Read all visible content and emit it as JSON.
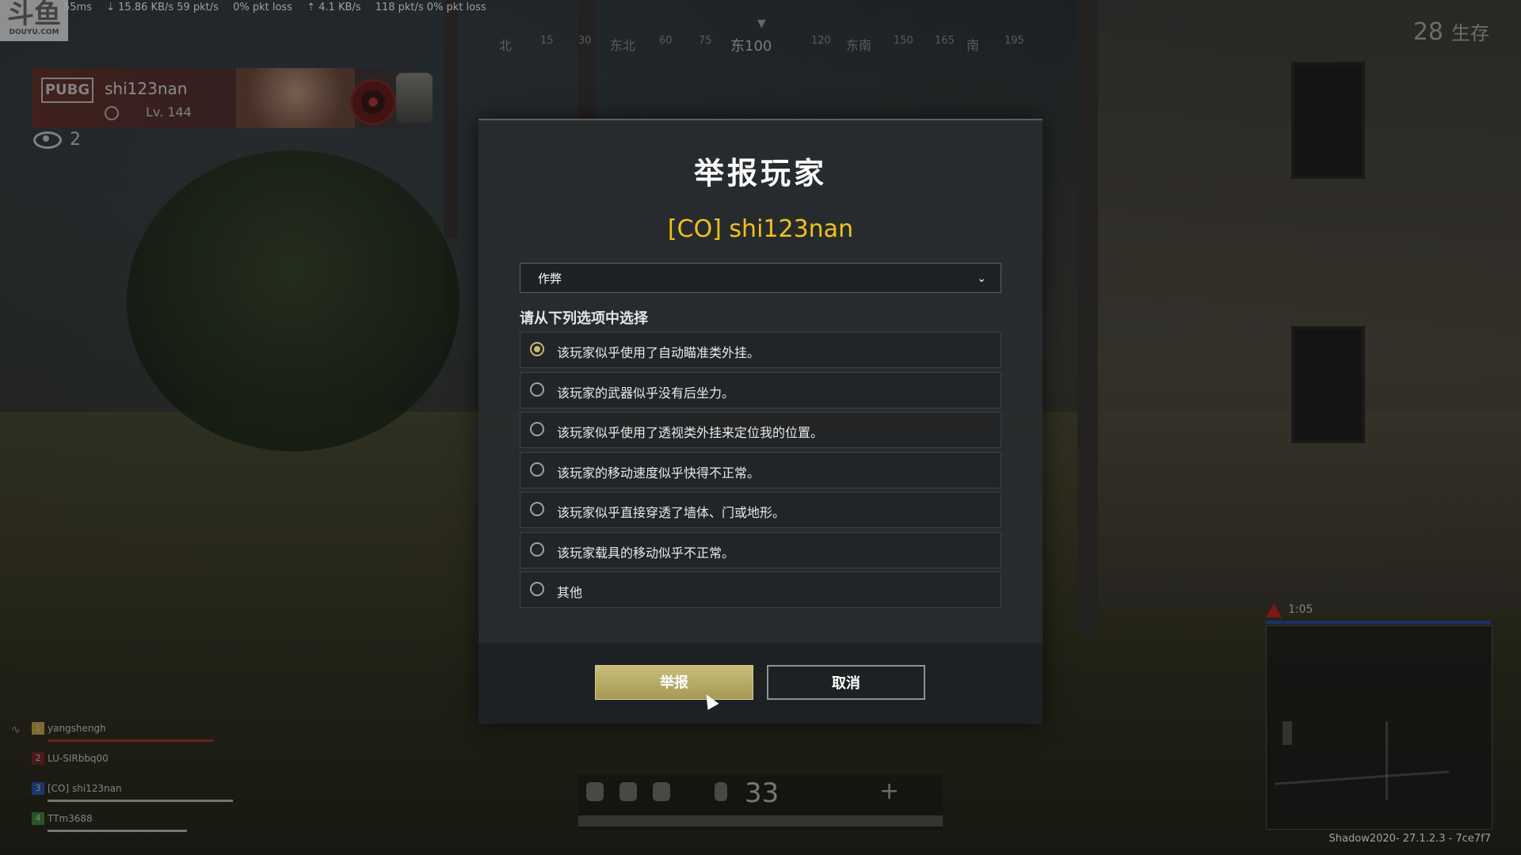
{
  "overlay": {
    "watermark_big": "斗鱼",
    "watermark_small": "DOUYU.COM",
    "net_stats": [
      "55ms",
      "⇣ 15.86 KB/s  59 pkt/s",
      "0% pkt loss",
      "⇡ 4.1 KB/s",
      "118 pkt/s  0% pkt loss"
    ]
  },
  "compass": {
    "ticks": [
      "北",
      "15",
      "30",
      "东北",
      "60",
      "75",
      "东100",
      "120",
      "东南",
      "150",
      "165",
      "南",
      "195"
    ]
  },
  "hud": {
    "alive_count": "28",
    "alive_label": "生存",
    "spectators": "2",
    "ammo": "33",
    "version": "Shadow2020- 27.1.2.3 - 7ce7f7",
    "zone_timer": "1:05"
  },
  "profile": {
    "logo": "PUBG",
    "name": "shi123nan",
    "level": "Lv. 144"
  },
  "team": [
    {
      "index": "1",
      "name": "yangshengh",
      "health": 0.9,
      "color": "#c8b04a"
    },
    {
      "index": "2",
      "name": "LU-SIRbbq00",
      "health": 0.0,
      "color": "#c43b3b"
    },
    {
      "index": "3",
      "name": "[CO] shi123nan",
      "health": 1.0,
      "color": "#4a7fd1"
    },
    {
      "index": "4",
      "name": "TTm3688",
      "health": 0.75,
      "color": "#4fa04f"
    }
  ],
  "dialog": {
    "title": "举报玩家",
    "player": "[CO] shi123nan",
    "category": "作弊",
    "prompt": "请从下列选项中选择",
    "options": [
      {
        "label": "该玩家似乎使用了自动瞄准类外挂。",
        "selected": true
      },
      {
        "label": "该玩家的武器似乎没有后坐力。",
        "selected": false
      },
      {
        "label": "该玩家似乎使用了透视类外挂来定位我的位置。",
        "selected": false
      },
      {
        "label": "该玩家的移动速度似乎快得不正常。",
        "selected": false
      },
      {
        "label": "该玩家似乎直接穿透了墙体、门或地形。",
        "selected": false
      },
      {
        "label": "该玩家载具的移动似乎不正常。",
        "selected": false
      },
      {
        "label": "其他",
        "selected": false
      }
    ],
    "report_label": "举报",
    "cancel_label": "取消"
  },
  "colors": {
    "accent_gold": "#f2c21a",
    "report_button": "#bfb36b"
  }
}
